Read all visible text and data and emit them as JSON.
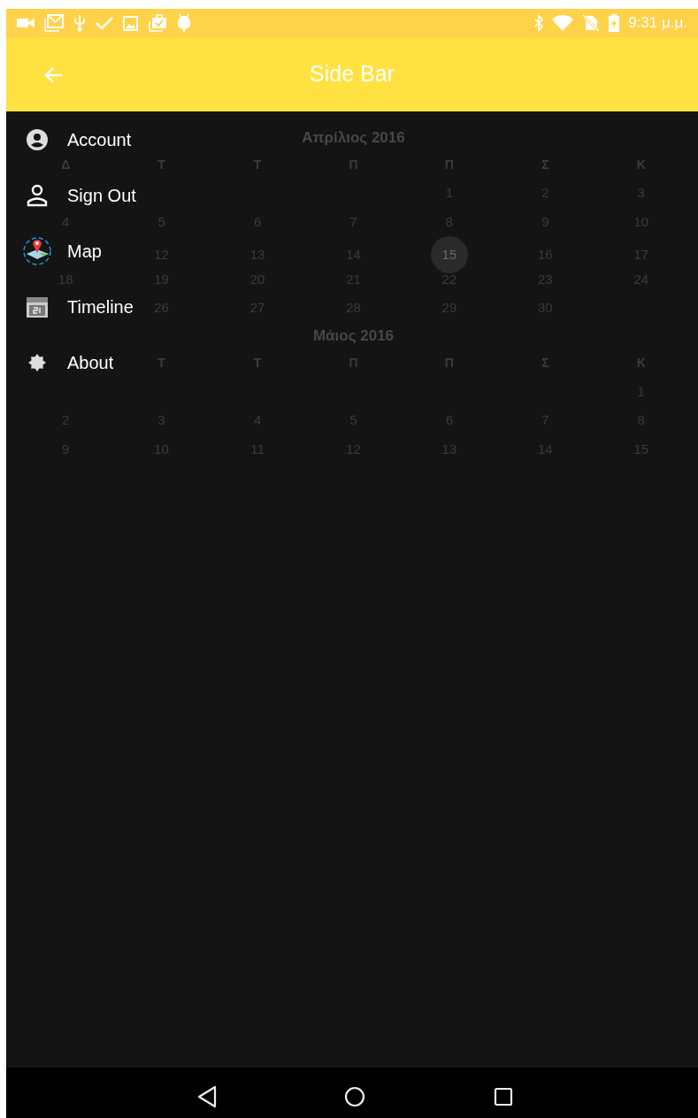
{
  "status_bar": {
    "time": "9:31 μ.μ."
  },
  "app_bar": {
    "title": "Side Bar"
  },
  "menu": {
    "items": [
      {
        "label": "Account"
      },
      {
        "label": "Sign Out"
      },
      {
        "label": "Map"
      },
      {
        "label": "Timeline"
      },
      {
        "label": "About"
      }
    ]
  },
  "calendar": {
    "months": [
      {
        "title": "Απρίλιος 2016",
        "weekdays": [
          {
            "kind": "label",
            "text": "Δ"
          },
          {
            "kind": "label",
            "text": "Τ"
          },
          {
            "kind": "label",
            "text": "Τ"
          },
          {
            "kind": "label",
            "text": "Π"
          },
          {
            "kind": "label",
            "text": "Π"
          },
          {
            "kind": "label",
            "text": "Σ"
          },
          {
            "kind": "label",
            "text": "Κ"
          }
        ],
        "weeks": [
          [
            {
              "kind": "blank"
            },
            {
              "kind": "blank"
            },
            {
              "kind": "blank"
            },
            {
              "kind": "blank"
            },
            {
              "kind": "day",
              "text": "1",
              "selected": false
            },
            {
              "kind": "day",
              "text": "2",
              "selected": false
            },
            {
              "kind": "day",
              "text": "3",
              "selected": false
            }
          ],
          [
            {
              "kind": "day",
              "text": "4",
              "selected": false
            },
            {
              "kind": "day",
              "text": "5",
              "selected": false
            },
            {
              "kind": "day",
              "text": "6",
              "selected": false
            },
            {
              "kind": "day",
              "text": "7",
              "selected": false
            },
            {
              "kind": "day",
              "text": "8",
              "selected": false
            },
            {
              "kind": "day",
              "text": "9",
              "selected": false
            },
            {
              "kind": "day",
              "text": "10",
              "selected": false
            }
          ],
          [
            {
              "kind": "blank"
            },
            {
              "kind": "day",
              "text": "12",
              "selected": false
            },
            {
              "kind": "day",
              "text": "13",
              "selected": false
            },
            {
              "kind": "day",
              "text": "14",
              "selected": false
            },
            {
              "kind": "day",
              "text": "15",
              "selected": true
            },
            {
              "kind": "day",
              "text": "16",
              "selected": false
            },
            {
              "kind": "day",
              "text": "17",
              "selected": false
            }
          ],
          [
            {
              "kind": "day",
              "text": "18",
              "selected": false
            },
            {
              "kind": "day",
              "text": "19",
              "selected": false
            },
            {
              "kind": "day",
              "text": "20",
              "selected": false
            },
            {
              "kind": "day",
              "text": "21",
              "selected": false
            },
            {
              "kind": "day",
              "text": "22",
              "selected": false
            },
            {
              "kind": "day",
              "text": "23",
              "selected": false
            },
            {
              "kind": "day",
              "text": "24",
              "selected": false
            }
          ],
          [
            {
              "kind": "blank"
            },
            {
              "kind": "day",
              "text": "26",
              "selected": false
            },
            {
              "kind": "day",
              "text": "27",
              "selected": false
            },
            {
              "kind": "day",
              "text": "28",
              "selected": false
            },
            {
              "kind": "day",
              "text": "29",
              "selected": false
            },
            {
              "kind": "day",
              "text": "30",
              "selected": false
            },
            {
              "kind": "blank"
            }
          ]
        ]
      },
      {
        "title": "Μάιος 2016",
        "weekdays": [
          {
            "kind": "blank"
          },
          {
            "kind": "label",
            "text": "Τ"
          },
          {
            "kind": "label",
            "text": "Τ"
          },
          {
            "kind": "label",
            "text": "Π"
          },
          {
            "kind": "label",
            "text": "Π"
          },
          {
            "kind": "label",
            "text": "Σ"
          },
          {
            "kind": "label",
            "text": "Κ"
          }
        ],
        "weeks": [
          [
            {
              "kind": "blank"
            },
            {
              "kind": "blank"
            },
            {
              "kind": "blank"
            },
            {
              "kind": "blank"
            },
            {
              "kind": "blank"
            },
            {
              "kind": "blank"
            },
            {
              "kind": "day",
              "text": "1",
              "selected": false
            }
          ],
          [
            {
              "kind": "day",
              "text": "2",
              "selected": false
            },
            {
              "kind": "day",
              "text": "3",
              "selected": false
            },
            {
              "kind": "day",
              "text": "4",
              "selected": false
            },
            {
              "kind": "day",
              "text": "5",
              "selected": false
            },
            {
              "kind": "day",
              "text": "6",
              "selected": false
            },
            {
              "kind": "day",
              "text": "7",
              "selected": false
            },
            {
              "kind": "day",
              "text": "8",
              "selected": false
            }
          ],
          [
            {
              "kind": "day",
              "text": "9",
              "selected": false
            },
            {
              "kind": "day",
              "text": "10",
              "selected": false
            },
            {
              "kind": "day",
              "text": "11",
              "selected": false
            },
            {
              "kind": "day",
              "text": "12",
              "selected": false
            },
            {
              "kind": "day",
              "text": "13",
              "selected": false
            },
            {
              "kind": "day",
              "text": "14",
              "selected": false
            },
            {
              "kind": "day",
              "text": "15",
              "selected": false
            }
          ]
        ]
      }
    ]
  }
}
